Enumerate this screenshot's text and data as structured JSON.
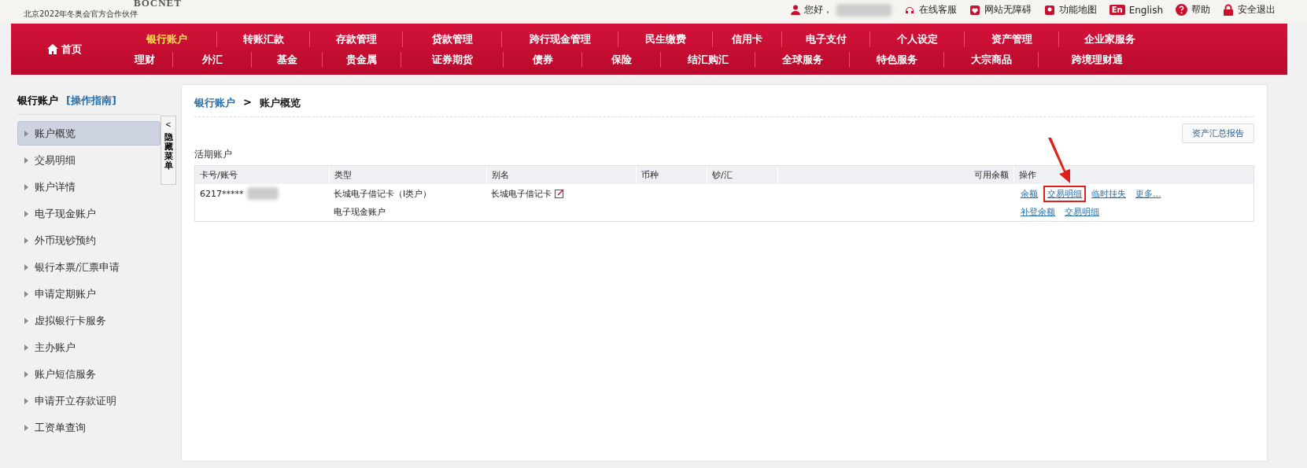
{
  "header": {
    "brand": "BOCNET",
    "tagline": "北京2022年冬奥会官方合作伙伴",
    "greeting": "您好，",
    "links": [
      {
        "kind": "service",
        "label": "在线客服"
      },
      {
        "kind": "access",
        "label": "网站无障碍"
      },
      {
        "kind": "map",
        "label": "功能地图"
      },
      {
        "kind": "lang",
        "badge": "En",
        "label": "English"
      },
      {
        "kind": "help",
        "label": "帮助"
      },
      {
        "kind": "logout",
        "label": "安全退出"
      }
    ]
  },
  "nav": {
    "home": "首页",
    "row_1": [
      {
        "label": "银行账户",
        "selected": true
      },
      {
        "label": "转账汇款",
        "selected": false
      },
      {
        "label": "存款管理",
        "selected": false
      },
      {
        "label": "贷款管理",
        "selected": false
      },
      {
        "label": "跨行现金管理",
        "selected": false
      },
      {
        "label": "民生缴费",
        "selected": false
      },
      {
        "label": "信用卡",
        "selected": false
      },
      {
        "label": "电子支付",
        "selected": false
      },
      {
        "label": "个人设定",
        "selected": false
      },
      {
        "label": "资产管理",
        "selected": false
      },
      {
        "label": "企业家服务",
        "selected": false
      }
    ],
    "row_2": [
      {
        "label": "理财",
        "selected": false
      },
      {
        "label": "外汇",
        "selected": false
      },
      {
        "label": "基金",
        "selected": false
      },
      {
        "label": "贵金属",
        "selected": false
      },
      {
        "label": "证券期货",
        "selected": false
      },
      {
        "label": "债券",
        "selected": false
      },
      {
        "label": "保险",
        "selected": false
      },
      {
        "label": "结汇购汇",
        "selected": false
      },
      {
        "label": "全球服务",
        "selected": false
      },
      {
        "label": "特色服务",
        "selected": false
      },
      {
        "label": "大宗商品",
        "selected": false
      },
      {
        "label": "跨境理财通",
        "selected": false
      }
    ]
  },
  "sidebar": {
    "title": "银行账户",
    "guide": "[操作指南]",
    "items": [
      {
        "label": "账户概览",
        "selected": true
      },
      {
        "label": "交易明细",
        "selected": false
      },
      {
        "label": "账户详情",
        "selected": false
      },
      {
        "label": "电子现金账户",
        "selected": false
      },
      {
        "label": "外币现钞预约",
        "selected": false
      },
      {
        "label": "银行本票/汇票申请",
        "selected": false
      },
      {
        "label": "申请定期账户",
        "selected": false
      },
      {
        "label": "虚拟银行卡服务",
        "selected": false
      },
      {
        "label": "主办账户",
        "selected": false
      },
      {
        "label": "账户短信服务",
        "selected": false
      },
      {
        "label": "申请开立存款证明",
        "selected": false
      },
      {
        "label": "工资单查询",
        "selected": false
      }
    ],
    "collapse_arrow": "<",
    "collapse_label": "隐藏菜单"
  },
  "content": {
    "breadcrumb": [
      {
        "label": "银行账户",
        "link": true
      },
      {
        "label": "账户概览",
        "link": false
      }
    ],
    "breadcrumb_separator": ">",
    "report_button": "资产汇总报告",
    "section_title": "活期账户",
    "table": {
      "columns": [
        "卡号/账号",
        "类型",
        "别名",
        "币种",
        "钞/汇",
        "可用余额",
        "操作"
      ],
      "rows": [
        {
          "account": "6217*****",
          "type": "长城电子借记卡（Ⅰ类户）",
          "alias": "长城电子借记卡",
          "editable": true,
          "actions": [
            {
              "label": "余额",
              "highlighted": false
            },
            {
              "label": "交易明细",
              "highlighted": true
            },
            {
              "label": "临时挂失",
              "highlighted": false
            },
            {
              "label": "更多...",
              "highlighted": false
            }
          ]
        },
        {
          "account": "",
          "type": "电子现金账户",
          "alias": "",
          "editable": false,
          "actions": [
            {
              "label": "补登余额",
              "highlighted": false
            },
            {
              "label": "交易明细",
              "highlighted": false
            }
          ]
        }
      ]
    }
  }
}
